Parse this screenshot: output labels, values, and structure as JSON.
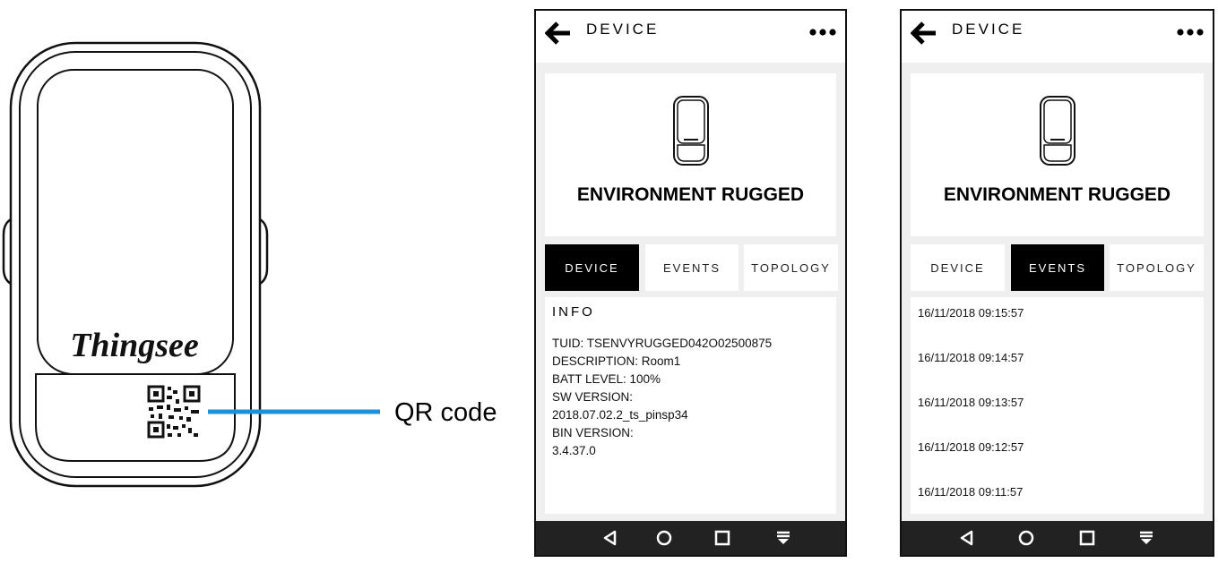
{
  "illustration": {
    "brand": "Thingsee",
    "callout_label": "QR code"
  },
  "phones": [
    {
      "topbar_title": "DEVICE",
      "device_name": "ENVIRONMENT RUGGED",
      "tabs": [
        "DEVICE",
        "EVENTS",
        "TOPOLOGY"
      ],
      "active_tab": "DEVICE",
      "info": {
        "title": "INFO",
        "lines": [
          "TUID: TSENVYRUGGED042O02500875",
          "DESCRIPTION: Room1",
          "BATT LEVEL: 100%",
          "SW VERSION:",
          "2018.07.02.2_ts_pinsp34",
          "BIN VERSION:",
          "3.4.37.0"
        ]
      }
    },
    {
      "topbar_title": "DEVICE",
      "device_name": "ENVIRONMENT RUGGED",
      "tabs": [
        "DEVICE",
        "EVENTS",
        "TOPOLOGY"
      ],
      "active_tab": "EVENTS",
      "events": [
        "16/11/2018 09:15:57",
        "16/11/2018 09:14:57",
        "16/11/2018 09:13:57",
        "16/11/2018 09:12:57",
        "16/11/2018 09:11:57"
      ]
    }
  ],
  "colors": {
    "callout_line": "#1b8fdc",
    "active_tab_bg": "#000000",
    "navbar_bg": "#222222",
    "screen_bg": "#efefef"
  },
  "icons": {
    "back": "arrow-left-icon",
    "more": "more-dots-icon",
    "nav_back": "triangle-back-icon",
    "nav_home": "circle-home-icon",
    "nav_recents": "square-recents-icon",
    "nav_menu": "menu-down-icon"
  }
}
